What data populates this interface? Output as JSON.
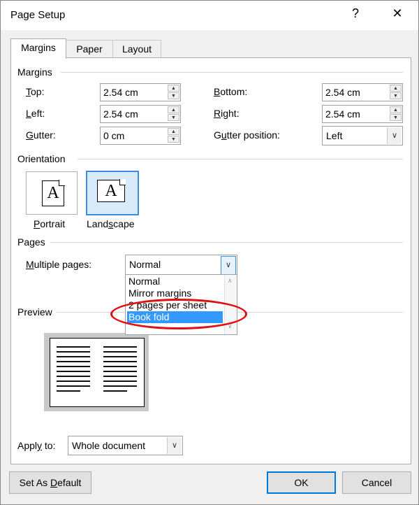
{
  "window": {
    "title": "Page Setup",
    "help_glyph": "?",
    "close_glyph": "✕"
  },
  "tabs": [
    {
      "label": "Margins"
    },
    {
      "label": "Paper"
    },
    {
      "label": "Layout"
    }
  ],
  "margins": {
    "section_label": "Margins",
    "top": {
      "label_u": "T",
      "label_rest": "op:",
      "value": "2.54 cm"
    },
    "left": {
      "label_u": "L",
      "label_rest": "eft:",
      "value": "2.54 cm"
    },
    "gutter": {
      "label_u": "G",
      "label_rest": "utter:",
      "value": "0 cm"
    },
    "bottom": {
      "label_u": "B",
      "label_rest": "ottom:",
      "value": "2.54 cm"
    },
    "right": {
      "label_u": "R",
      "label_rest": "ight:",
      "value": "2.54 cm"
    },
    "gutter_position": {
      "label_pre": "G",
      "label_u": "u",
      "label_rest": "tter position:",
      "value": "Left"
    }
  },
  "orientation": {
    "section_label": "Orientation",
    "portrait": {
      "label_u": "P",
      "label_rest": "ortrait",
      "glyph": "A"
    },
    "landscape": {
      "label_u": "s",
      "label_pre": "Land",
      "label_rest": "cape",
      "glyph": "A"
    }
  },
  "pages": {
    "section_label": "Pages",
    "multiple_pages": {
      "label_u": "M",
      "label_rest": "ultiple pages:",
      "value": "Normal"
    },
    "options": [
      "Normal",
      "Mirror margins",
      "2 pages per sheet",
      "Book fold"
    ],
    "selected_option": "Book fold"
  },
  "preview": {
    "section_label": "Preview"
  },
  "apply_to": {
    "label_pre": "Appl",
    "label_u": "y",
    "label_rest": " to:",
    "value": "Whole document"
  },
  "buttons": {
    "set_default": {
      "pre": "Set As ",
      "u": "D",
      "rest": "efault"
    },
    "ok": "OK",
    "cancel": "Cancel"
  },
  "colors": {
    "accent": "#0078d7",
    "highlight": "#3399ff",
    "annotation": "#e01010"
  }
}
